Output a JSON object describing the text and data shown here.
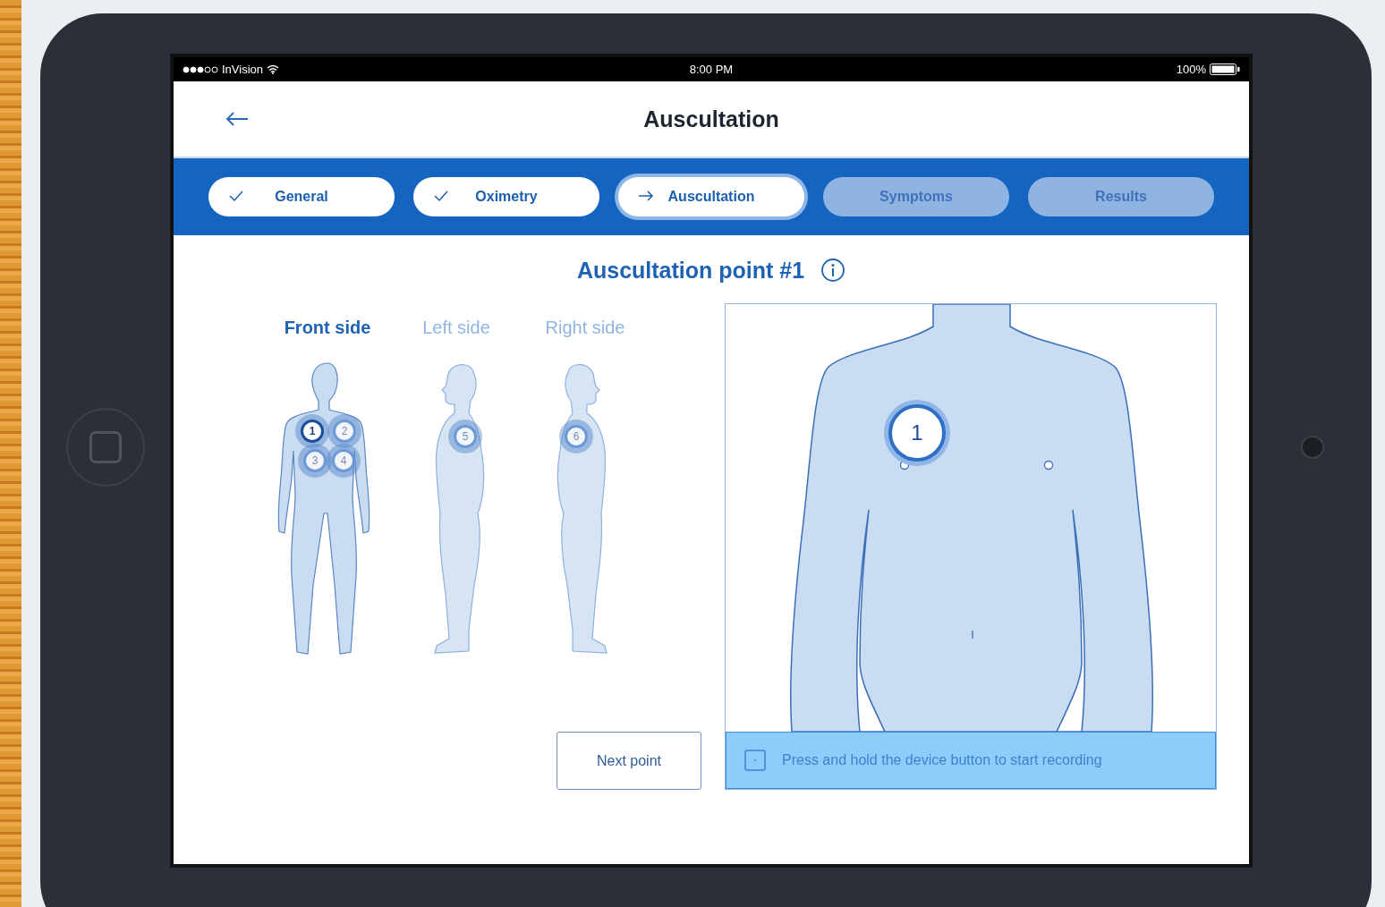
{
  "status_bar": {
    "carrier": "InVision",
    "time": "8:00 PM",
    "battery": "100%"
  },
  "header": {
    "title": "Auscultation"
  },
  "steps": [
    {
      "label": "General",
      "kind": "done",
      "selected": false
    },
    {
      "label": "Oximetry",
      "kind": "done",
      "selected": false
    },
    {
      "label": "Auscultation",
      "kind": "current",
      "selected": true
    },
    {
      "label": "Symptoms",
      "kind": "pending",
      "selected": false
    },
    {
      "label": "Results",
      "kind": "pending",
      "selected": false
    }
  ],
  "heading": "Auscultation point #1",
  "views": [
    {
      "label": "Front side",
      "kind": "front",
      "selected": true,
      "points": [
        {
          "label": "1",
          "selected": true
        },
        {
          "label": "2",
          "selected": false
        },
        {
          "label": "3",
          "selected": false
        },
        {
          "label": "4",
          "selected": false
        }
      ]
    },
    {
      "label": "Left side",
      "kind": "left",
      "selected": false,
      "points": [
        {
          "label": "5",
          "selected": false
        }
      ]
    },
    {
      "label": "Right side",
      "kind": "right",
      "selected": false,
      "points": [
        {
          "label": "6",
          "selected": false
        }
      ]
    }
  ],
  "detail": {
    "marker": "1",
    "instruction": "Press and hold the device button to start recording"
  },
  "next_button": "Next point"
}
